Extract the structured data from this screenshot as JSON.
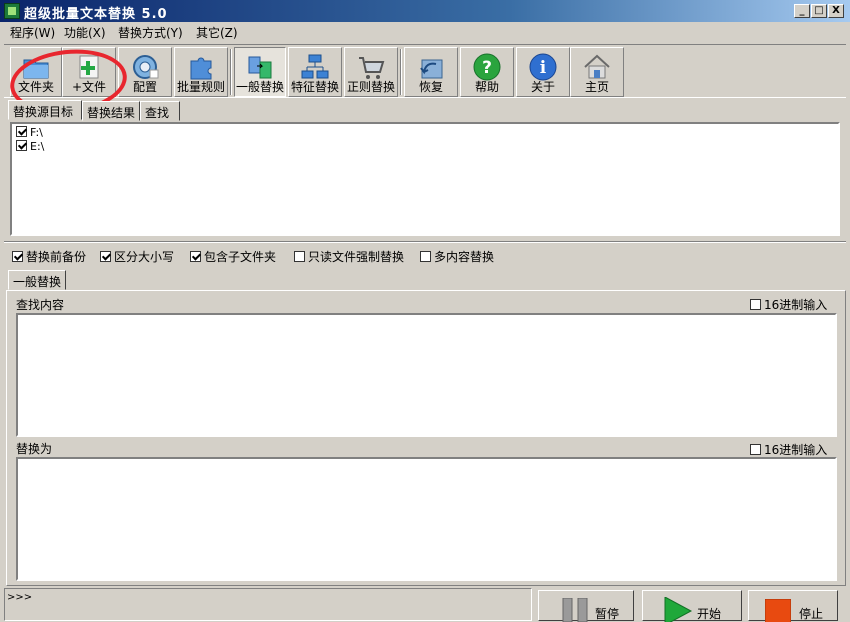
{
  "window": {
    "title": "超级批量文本替换 5.0",
    "min": "_",
    "max": "□",
    "close": "X"
  },
  "menu": [
    "程序(W)",
    "功能(X)",
    "替换方式(Y)",
    "其它(Z)"
  ],
  "toolbar": {
    "folder": "文件夹",
    "add_file": "+文件",
    "config": "配置",
    "batch_rules": "批量规则",
    "general_replace": "一般替换",
    "feature_replace": "特征替换",
    "regex_replace": "正则替换",
    "restore": "恢复",
    "help": "帮助",
    "about": "关于",
    "homepage": "主页"
  },
  "source_tabs": [
    "替换源目标",
    "替换结果",
    "查找"
  ],
  "sources": [
    {
      "path": "F:\\",
      "checked": true
    },
    {
      "path": "E:\\",
      "checked": true
    }
  ],
  "options": [
    {
      "label": "替换前备份",
      "checked": true
    },
    {
      "label": "区分大小写",
      "checked": true
    },
    {
      "label": "包含子文件夹",
      "checked": true
    },
    {
      "label": "只读文件强制替换",
      "checked": false
    },
    {
      "label": "多内容替换",
      "checked": false
    }
  ],
  "replace_tab": "一般替换",
  "find": {
    "label": "查找内容",
    "hex_label": "16进制输入",
    "value": ""
  },
  "replace": {
    "label": "替换为",
    "hex_label": "16进制输入",
    "value": ""
  },
  "status": {
    "prompt": ">>>"
  },
  "actions": {
    "pause": "暂停",
    "start": "开始",
    "stop": "停止"
  },
  "colors": {
    "annotation": "#e8262e",
    "start_green": "#1fa83a",
    "stop_orange": "#e84a10"
  }
}
